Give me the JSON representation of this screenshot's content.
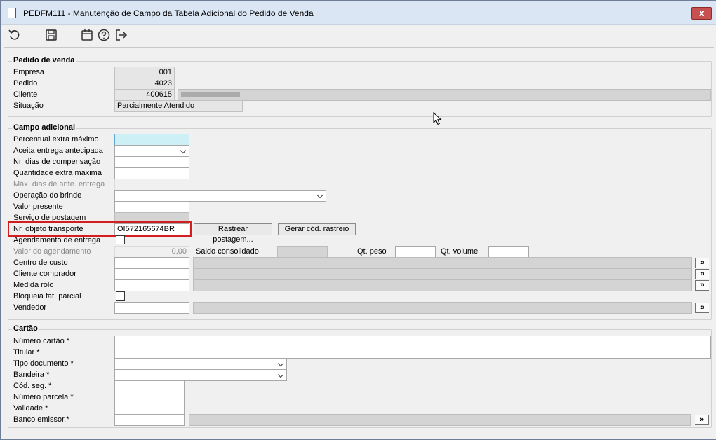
{
  "window": {
    "title": "PEDFM111 - Manutenção de Campo da Tabela Adicional do Pedido de Venda",
    "close": "x"
  },
  "toolbar": {
    "icons": [
      "undo-icon",
      "save-icon",
      "calendar-icon",
      "help-icon",
      "exit-icon"
    ]
  },
  "pedido": {
    "title": "Pedido de venda",
    "empresa_label": "Empresa",
    "empresa_value": "001",
    "pedido_label": "Pedido",
    "pedido_value": "4023",
    "cliente_label": "Cliente",
    "cliente_value": "400615",
    "situacao_label": "Situação",
    "situacao_value": "Parcialmente Atendido"
  },
  "adicional": {
    "title": "Campo adicional",
    "percentual_label": "Percentual extra máximo",
    "aceita_label": "Aceita entrega antecipada",
    "dias_comp_label": "Nr. dias de compensação",
    "qtd_extra_label": "Quantidade extra máxima",
    "max_dias_label": "Máx. dias de ante. entrega",
    "operacao_label": "Operação do brinde",
    "valor_presente_label": "Valor presente",
    "servico_label": "Serviço de postagem",
    "objeto_label": "Nr. objeto transporte",
    "objeto_value": "OI572165674BR",
    "rastrear_button": "Rastrear postagem...",
    "gerar_button": "Gerar cód. rastreio",
    "agendamento_label": "Agendamento de entrega",
    "valor_agend_label": "Valor do agendamento",
    "valor_agend_value": "0,00",
    "saldo_label": "Saldo consolidado",
    "qt_peso_label": "Qt. peso",
    "qt_volume_label": "Qt. volume",
    "centro_label": "Centro de custo",
    "cliente_comprador_label": "Cliente comprador",
    "medida_label": "Medida rolo",
    "bloqueia_label": "Bloqueia fat. parcial",
    "vendedor_label": "Vendedor",
    "lookup": "»"
  },
  "cartao": {
    "title": "Cartão",
    "numero_label": "Número cartão *",
    "titular_label": "Titular *",
    "tipo_doc_label": "Tipo documento *",
    "bandeira_label": "Bandeira *",
    "cod_seg_label": "Cód. seg. *",
    "num_parcela_label": "Número parcela *",
    "validade_label": "Validade *",
    "banco_label": "Banco emissor.*",
    "lookup": "»"
  },
  "colors": {
    "highlight": "#d21e1e",
    "focus_field": "#cdeff6",
    "titlebar": "#dbe6f4",
    "close": "#c75050"
  }
}
